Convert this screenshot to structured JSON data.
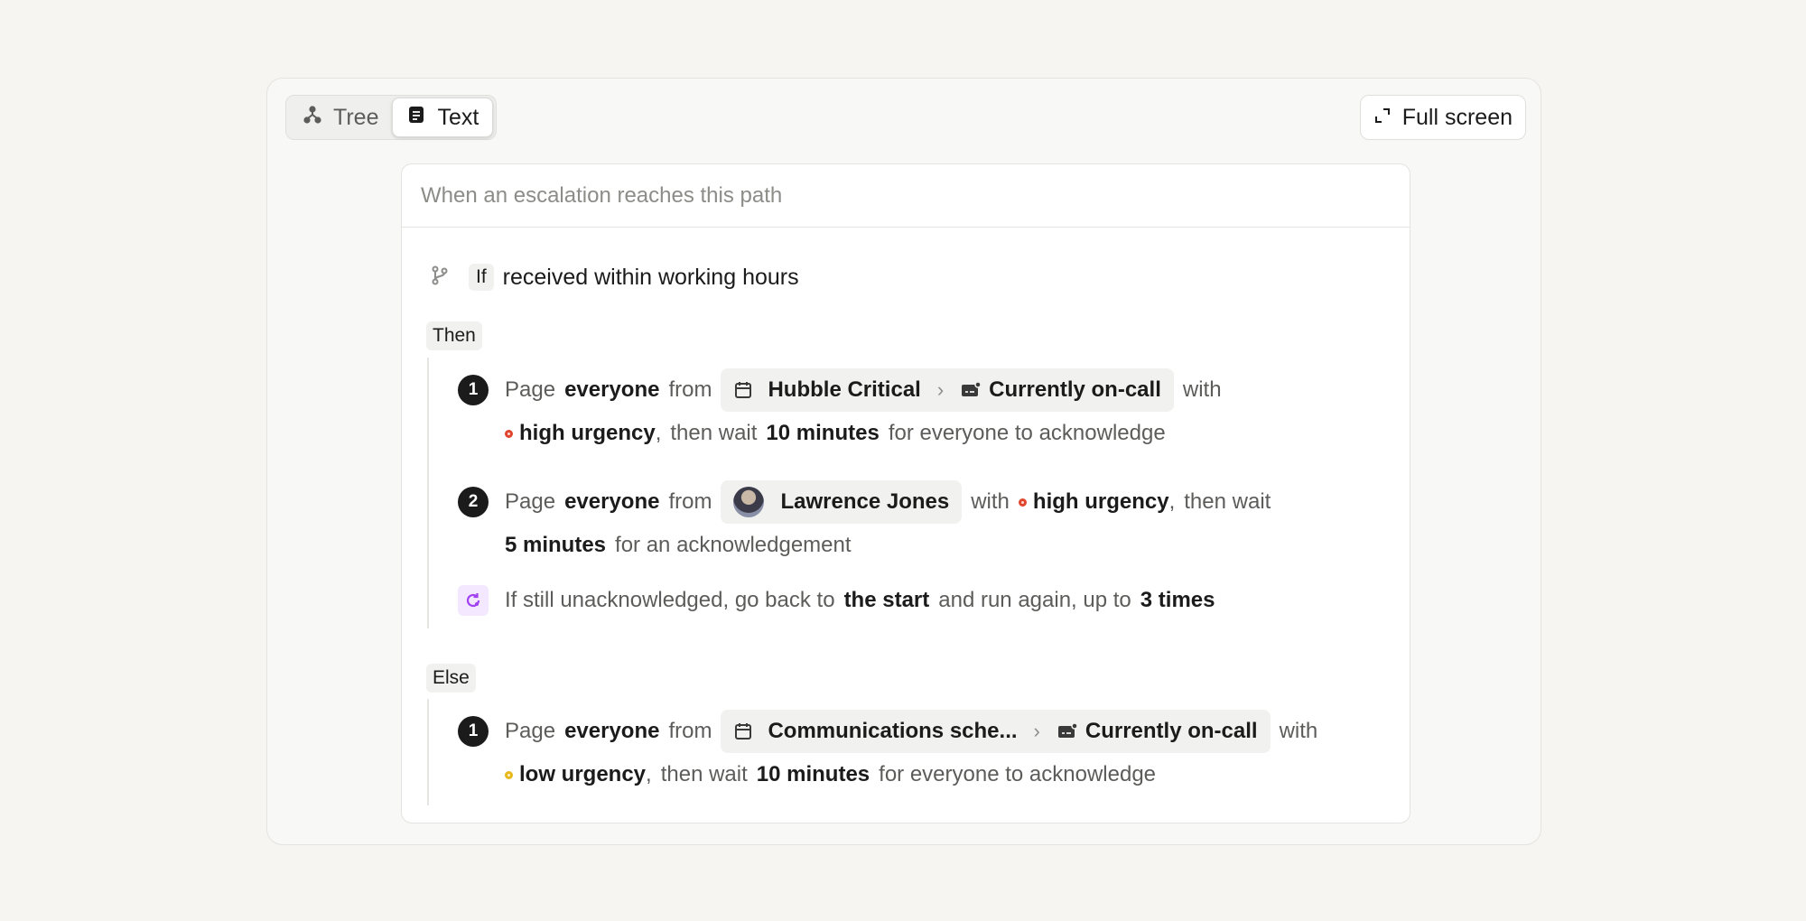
{
  "toolbar": {
    "tabs": [
      {
        "label": "Tree",
        "icon": "tree-icon",
        "active": false
      },
      {
        "label": "Text",
        "icon": "text-doc-icon",
        "active": true
      }
    ],
    "full_screen_label": "Full screen"
  },
  "card": {
    "header_placeholder": "When an escalation reaches this path",
    "condition": {
      "badge": "If",
      "text": "received within working hours"
    },
    "then_branch": {
      "label": "Then",
      "steps": [
        {
          "number": "1",
          "page_word": "Page",
          "target": "everyone",
          "from_word": "from",
          "schedule": "Hubble Critical",
          "rota": "Currently on-call",
          "with_word": "with",
          "urgency": "high urgency",
          "urgency_color": "#e0462e",
          "then_wait": "then wait",
          "duration": "10 minutes",
          "tail": "for everyone to acknowledge"
        },
        {
          "number": "2",
          "page_word": "Page",
          "target": "everyone",
          "from_word": "from",
          "user": "Lawrence Jones",
          "with_word": "with",
          "urgency": "high urgency",
          "urgency_color": "#e0462e",
          "then_wait": "then wait",
          "duration": "5 minutes",
          "tail": "for an acknowledgement"
        }
      ],
      "repeat": {
        "prefix": "If still unacknowledged, go back to",
        "target": "the start",
        "middle": "and run again, up to",
        "count": "3 times"
      }
    },
    "else_branch": {
      "label": "Else",
      "steps": [
        {
          "number": "1",
          "page_word": "Page",
          "target": "everyone",
          "from_word": "from",
          "schedule": "Communications sche...",
          "rota": "Currently on-call",
          "with_word": "with",
          "urgency": "low urgency",
          "urgency_color": "#e6b81b",
          "then_wait": "then wait",
          "duration": "10 minutes",
          "tail": "for everyone to acknowledge"
        }
      ]
    }
  }
}
